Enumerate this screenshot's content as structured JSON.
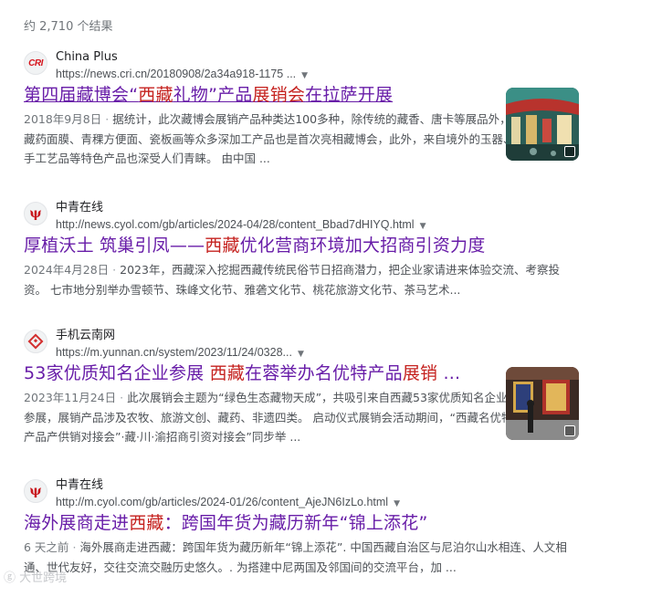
{
  "stats": "约 2,710 个结果",
  "results": [
    {
      "site_name": "China Plus",
      "url": "https://news.cri.cn/20180908/2a34a918-1175 ...",
      "favicon": "cri-logo-icon",
      "favicon_text": "CRI",
      "title_parts": [
        "第四届藏博会“",
        "西藏",
        "礼物",
        "”产品",
        "展销会",
        "在拉萨开展"
      ],
      "date": "2018年9月8日",
      "snippet": "据统计，此次藏博会展销产品种类达100多种，除传统的藏香、唐卡等展品外，藏药面膜、青稞方便面、瓷板画等众多深加工产品也是首次亮相藏博会，此外，来自境外的玉器、手工艺品等特色产品也深受人们青睐。 由中国 ..."
    },
    {
      "site_name": "中青在线",
      "url": "http://news.cyol.com/gb/articles/2024-04/28/content_Bbad7dHIYQ.html",
      "favicon": "cyol-logo-icon",
      "favicon_text": "中青",
      "title_parts": [
        "厚植沃土 筑巢引凤——",
        "西藏",
        "优化营商环境加大招商引资力度"
      ],
      "date": "2024年4月28日",
      "snippet": "2023年，西藏深入挖掘西藏传统民俗节日招商潜力，把企业家请进来体验交流、考察投资。 七市地分别举办雪顿节、珠峰文化节、雅砻文化节、桃花旅游文化节、茶马艺术..."
    },
    {
      "site_name": "手机云南网",
      "url": "https://m.yunnan.cn/system/2023/11/24/0328...",
      "favicon": "yunnan-logo-icon",
      "title_parts": [
        "53家优质知名企业参展 ",
        "西藏",
        "在蓉举办名优特产品",
        "展销",
        " ..."
      ],
      "date": "2023年11月24日",
      "snippet": "此次展销会主题为“绿色生态藏物天成”，共吸引来自西藏53家优质知名企业参展，展销产品涉及农牧、旅游文创、藏药、非遗四类。 启动仪式展销会活动期间，“西藏名优特产品产供销对接会”·藏·川·渝招商引资对接会”同步举 ..."
    },
    {
      "site_name": "中青在线",
      "url": "http://m.cyol.com/gb/articles/2024-01/26/content_AjeJN6IzLo.html",
      "favicon": "cyol-logo-icon",
      "favicon_text": "中青",
      "title_parts": [
        "海外展商走进",
        "西藏",
        "：跨国年货为藏历新年“锦上添花”"
      ],
      "date": "6 天之前",
      "snippet": "海外展商走进西藏：跨国年货为藏历新年“锦上添花”. 中国西藏自治区与尼泊尔山水相连、人文相通、世代友好，交往交流交融历史悠久。. 为搭建中尼两国及邻国间的交流平台，加 ..."
    }
  ],
  "watermark": "大世跨境",
  "colors": {
    "link": "#1a0dab",
    "visited": "#681da8",
    "highlight": "#c5221f",
    "snippet": "#4d5156"
  }
}
